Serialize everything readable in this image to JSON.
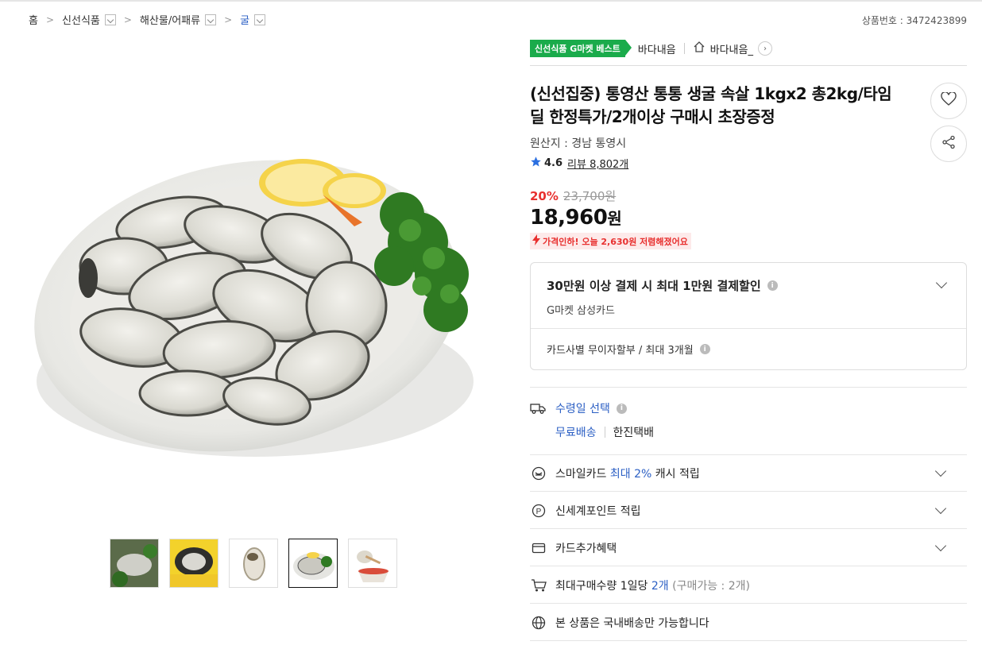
{
  "breadcrumb": {
    "home": "홈",
    "level1": "신선식품",
    "level2": "해산물/어패류",
    "level3": "굴"
  },
  "product_no": "상품번호 : 3472423899",
  "seller": {
    "badge": "신선식품 G마켓 베스트",
    "name": "바다내음",
    "store": "바다내음_"
  },
  "product": {
    "title_line1": "(신선집중) 통영산 통통 생굴 속살 1kgx2 총2kg/타임",
    "title_line2": "딜 한정특가/2개이상 구매시 초장증정",
    "origin": "원산지 : 경남 통영시",
    "rating": "4.6",
    "review_label": "리뷰 8,802개"
  },
  "price": {
    "discount": "20%",
    "original": "23,700원",
    "current": "18,960",
    "unit": "원",
    "drop_notice": "가격인하! 오늘 2,630원 저렴해졌어요"
  },
  "card_offer": {
    "title": "30만원 이상 결제 시 최대 1만원 결제할인",
    "sub": "G마켓 삼성카드",
    "installment": "카드사별 무이자할부 / 최대 3개월"
  },
  "delivery": {
    "select_label": "수령일 선택",
    "free": "무료배송",
    "courier": "한진택배"
  },
  "benefits": {
    "smile_prefix": "스마일카드 ",
    "smile_highlight": "최대 2%",
    "smile_suffix": " 캐시 적립",
    "shinsegae": "신세계포인트 적립",
    "card_extra": "카드추가혜택",
    "limit_prefix": "최대구매수량 1일당 ",
    "limit_highlight": "2개",
    "limit_suffix": " (구매가능 : 2개)",
    "domestic": "본 상품은 국내배송만 가능합니다"
  },
  "colors": {
    "accent_red": "#e8302f",
    "accent_blue": "#2b5fc4",
    "best_green": "#1aab4b",
    "star_blue": "#2b6fe0"
  },
  "icons": [
    "heart-icon",
    "share-icon",
    "star-icon",
    "home-icon",
    "truck-icon",
    "smile-icon",
    "point-icon",
    "card-icon",
    "cart-icon",
    "globe-icon",
    "chevron-down-icon",
    "info-icon"
  ]
}
